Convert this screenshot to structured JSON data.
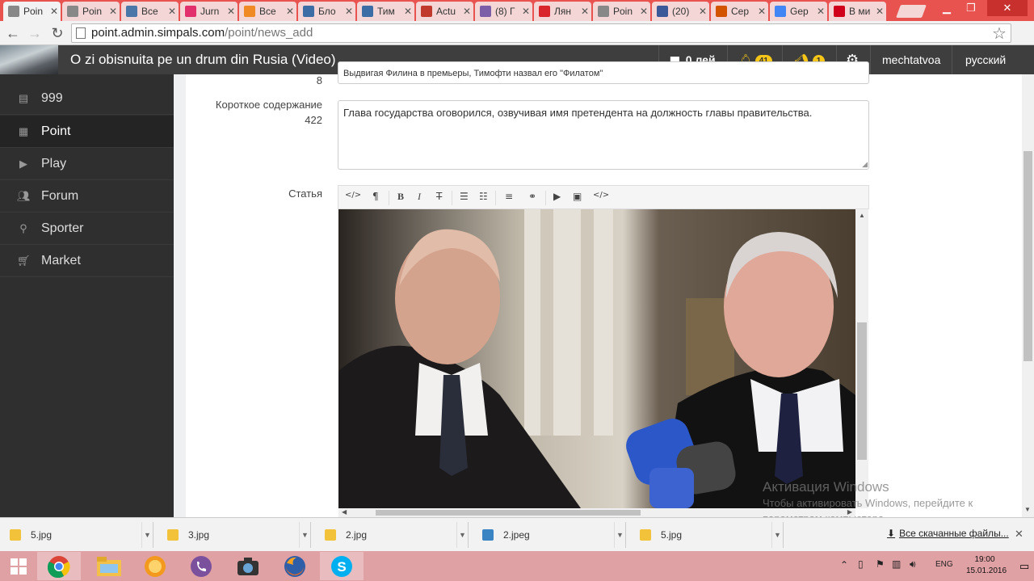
{
  "browser": {
    "tabs": [
      {
        "label": "Poin",
        "favicon": "page-icon",
        "color": "#888888",
        "active": true
      },
      {
        "label": "Poin",
        "favicon": "page-icon",
        "color": "#888888"
      },
      {
        "label": "Все",
        "favicon": "vk-icon",
        "color": "#4a76a8"
      },
      {
        "label": "Jurn",
        "favicon": "jurnal-icon",
        "color": "#e1306c"
      },
      {
        "label": "Все",
        "favicon": "rss-icon",
        "color": "#f08a24"
      },
      {
        "label": "Бло",
        "favicon": "b-icon",
        "color": "#3c6ea5"
      },
      {
        "label": "Тим",
        "favicon": "b-icon",
        "color": "#3c6ea5"
      },
      {
        "label": "Actu",
        "favicon": "actu-icon",
        "color": "#c0392b"
      },
      {
        "label": "(8) Г",
        "favicon": "instagram-icon",
        "color": "#7b5ea7"
      },
      {
        "label": "Лян",
        "favicon": "nm-icon",
        "color": "#d9262c"
      },
      {
        "label": "Poin",
        "favicon": "page-icon",
        "color": "#888888"
      },
      {
        "label": "(20)",
        "favicon": "facebook-icon",
        "color": "#3b5998"
      },
      {
        "label": "Сер",
        "favicon": "bird-icon",
        "color": "#d35400"
      },
      {
        "label": "Gер",
        "favicon": "google-icon",
        "color": "#4285f4"
      },
      {
        "label": "В ми",
        "favicon": "li-icon",
        "color": "#d0021b"
      }
    ],
    "url_host": "point.admin.simpals.com",
    "url_path": "/point/news_add"
  },
  "header": {
    "title": "O zi obisnuita pe un drum din Rusia (Video)",
    "wallet": "0 лей",
    "notifications_count": "41",
    "alerts_count": "1",
    "username": "mechtatvoa",
    "language": "русский"
  },
  "sidebar": {
    "items": [
      {
        "label": "999",
        "icon": "list-icon"
      },
      {
        "label": "Point",
        "icon": "news-icon",
        "active": true
      },
      {
        "label": "Play",
        "icon": "play-icon"
      },
      {
        "label": "Forum",
        "icon": "users-icon"
      },
      {
        "label": "Sporter",
        "icon": "bicycle-icon"
      },
      {
        "label": "Market",
        "icon": "cart-icon"
      }
    ]
  },
  "form": {
    "title_counter": "8",
    "title_value": "Выдвигая Филина в премьеры, Тимофти назвал его \"Филатом\"",
    "summary_label": "Короткое содержание",
    "summary_counter": "422",
    "summary_value": "Глава государства оговорился, озвучивая имя претендента на должность главы правительства.",
    "article_label": "Статья"
  },
  "editor_toolbar": {
    "html": "</>",
    "paragraph": "¶",
    "bold": "B",
    "italic": "I",
    "strike": "T",
    "ul": "☰",
    "ol": "☷",
    "align": "≡",
    "link": "⚭",
    "video": "▶",
    "image": "▣",
    "code": "</>"
  },
  "watermark": {
    "title": "Активация Windows",
    "subtitle": "Чтобы активировать Windows, перейдите к параметрам компьютера."
  },
  "downloads": {
    "items": [
      {
        "name": "5.jpg",
        "icon": "jpg-icon"
      },
      {
        "name": "3.jpg",
        "icon": "jpg-icon"
      },
      {
        "name": "2.jpg",
        "icon": "jpg-icon"
      },
      {
        "name": "2.jpeg",
        "icon": "image-icon"
      },
      {
        "name": "5.jpg",
        "icon": "jpg-icon"
      }
    ],
    "all_label": "Все скачанные файлы..."
  },
  "taskbar": {
    "apps": [
      "windows-start-icon",
      "chrome-icon",
      "file-explorer-icon",
      "orange-app-icon",
      "viber-icon",
      "camera-app-icon",
      "firefox-icon",
      "skype-icon"
    ],
    "lang": "ENG",
    "time": "19:00",
    "date": "15.01.2016"
  },
  "colors": {
    "tabstrip": "#e8524f",
    "app_header": "#3e3e3e",
    "sidebar": "#2f2f2f",
    "badge": "#f5c518",
    "taskbar": "#e0a1a4"
  }
}
